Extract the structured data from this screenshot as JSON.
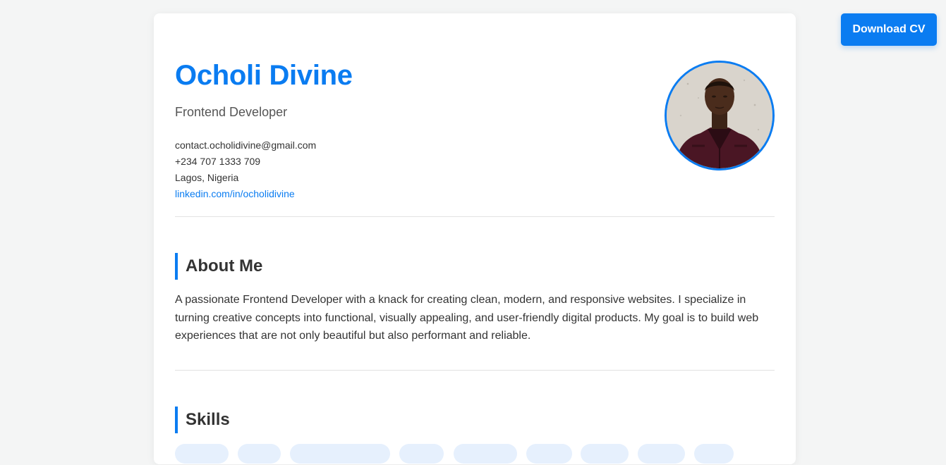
{
  "toolbar": {
    "download_label": "Download CV"
  },
  "profile": {
    "name": "Ocholi Divine",
    "role": "Frontend Developer",
    "email": "contact.ocholidivine@gmail.com",
    "phone": "+234 707 1333 709",
    "location": "Lagos, Nigeria",
    "linkedin": "linkedin.com/in/ocholidivine",
    "photo_alt": "Ocholi Divine"
  },
  "about": {
    "heading": "About Me",
    "text": "A passionate Frontend Developer with a knack for creating clean, modern, and responsive websites. I specialize in turning creative concepts into functional, visually appealing, and user-friendly digital products. My goal is to build web experiences that are not only beautiful but also performant and reliable."
  },
  "skills": {
    "heading": "Skills"
  },
  "colors": {
    "accent": "#0a7cf1",
    "page_background": "#f4f5f5",
    "card_background": "#ffffff",
    "skill_pill_background": "#e6f0fd"
  },
  "icons": {
    "avatar": "profile-photo"
  }
}
